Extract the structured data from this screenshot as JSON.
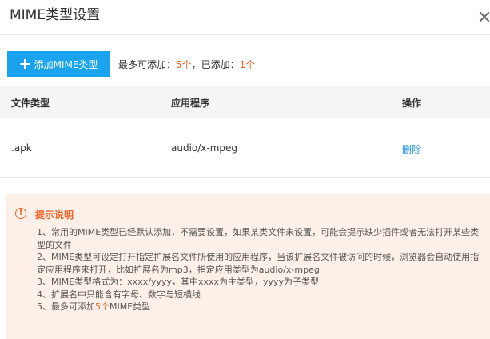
{
  "dialog": {
    "title": "MIME类型设置"
  },
  "toolbar": {
    "add_label": "添加MIME类型",
    "limit_prefix": "最多可添加：",
    "limit_max": "5个",
    "added_prefix": "，已添加：",
    "added_count": "1个"
  },
  "table": {
    "columns": [
      "文件类型",
      "应用程序",
      "操作"
    ],
    "rows": [
      {
        "ext": ".apk",
        "app": "audio/x-mpeg",
        "action": "删除"
      }
    ]
  },
  "tips": {
    "title": "提示说明",
    "items": [
      "1、常用的MIME类型已经默认添加，不需要设置，如果某类文件未设置，可能会提示缺少插件或者无法打开某些类型的文件",
      "2、MIME类型可设定打开指定扩展名文件所使用的应用程序，当该扩展名文件被访问的时候，浏览器会自动使用指定应用程序来打开，比如扩展名为mp3，指定应用类型为audio/x-mpeg",
      "3、MIME类型格式为：xxxx/yyyy，其中xxxx为主类型，yyyy为子类型",
      "4、扩展名中只能含有字母、数字与短横线"
    ],
    "last_prefix": "5、最多可添加",
    "last_num": "5个",
    "last_suffix": "MIME类型"
  },
  "colors": {
    "primary": "#1aa4f0",
    "warning": "#f0672e",
    "link": "#1a8fe6",
    "tips_bg": "#fdf0e8"
  }
}
